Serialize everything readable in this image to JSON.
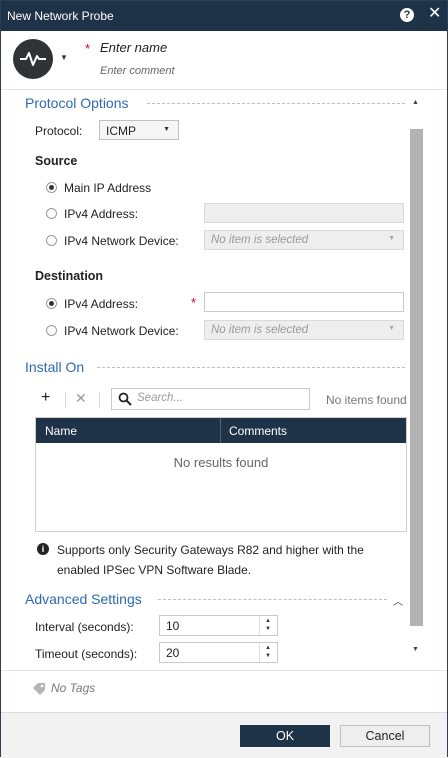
{
  "window": {
    "title": "New Network Probe",
    "help_icon": "question-icon",
    "close_icon": "close-icon"
  },
  "header": {
    "name_placeholder": "Enter name",
    "comment_placeholder": "Enter comment",
    "required_mark": "*"
  },
  "protocol_options": {
    "title": "Protocol Options",
    "protocol_label": "Protocol:",
    "protocol_value": "ICMP",
    "source": {
      "title": "Source",
      "options": [
        "Main IP Address",
        "IPv4 Address:",
        "IPv4 Network Device:"
      ],
      "selected": "Main IP Address",
      "device_placeholder": "No item is selected"
    },
    "destination": {
      "title": "Destination",
      "options": [
        "IPv4 Address:",
        "IPv4 Network Device:"
      ],
      "selected": "IPv4 Address:",
      "address_value": "",
      "required_mark": "*",
      "device_placeholder": "No item is selected"
    }
  },
  "install_on": {
    "title": "Install On",
    "add_icon": "plus-icon",
    "remove_icon": "x-icon",
    "search_placeholder": "Search...",
    "status": "No items found",
    "columns": [
      "Name",
      "Comments"
    ],
    "empty_text": "No results found"
  },
  "info": {
    "icon": "info-icon",
    "text": "Supports only Security Gateways R82 and higher with the enabled IPSec VPN Software Blade."
  },
  "advanced": {
    "title": "Advanced Settings",
    "interval_label": "Interval (seconds):",
    "interval_value": "10",
    "timeout_label": "Timeout (seconds):",
    "timeout_value": "20"
  },
  "tags": {
    "icon": "tag-icon",
    "text": "No Tags"
  },
  "footer": {
    "ok_label": "OK",
    "cancel_label": "Cancel"
  },
  "colors": {
    "titlebar": "#1e3348",
    "section_title": "#2d6ab1",
    "required": "#d0021b"
  }
}
